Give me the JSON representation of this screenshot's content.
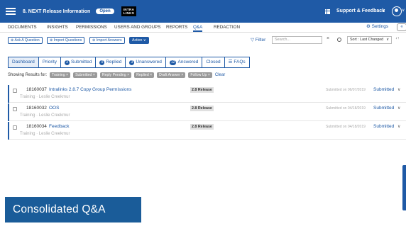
{
  "header": {
    "app_title": "8. NEXT Release Information",
    "status_pill": "Open",
    "logo_line1": "INTRA",
    "logo_line2": "LINKS",
    "support_label": "Support & Feedback",
    "chevron": "∨",
    "user_chevron": "∨",
    "colors": {
      "brand": "#1f5aa6",
      "caption_bg": "#1a5c99"
    }
  },
  "nav": {
    "items": [
      "DOCUMENTS",
      "INSIGHTS",
      "PERMISSIONS",
      "USERS AND GROUPS",
      "REPORTS",
      "Q&A",
      "REDACTION"
    ],
    "active": "Q&A",
    "settings_label": "⚙ Settings",
    "collapse_glyph": "«"
  },
  "toolbar": {
    "ask_question": "⊕ Ask A Question",
    "import_questions": "⊕ Import Questions",
    "import_answers": "⊕ Import Answers",
    "action": "Action ∨",
    "filter_label": "▽ Filter",
    "search_placeholder": "Search...",
    "clear_glyph": "×",
    "sort_label": "Sort : Last Changed",
    "sort_chevron": "∨",
    "sort_direction_glyph": "↓↑"
  },
  "tabs": [
    {
      "label": "Dashboard",
      "badge": ""
    },
    {
      "label": "Priority",
      "badge": ""
    },
    {
      "label": "Submitted",
      "badge": "3"
    },
    {
      "label": "Replied",
      "badge": "0"
    },
    {
      "label": "Unanswered",
      "badge": "3"
    },
    {
      "label": "Answered",
      "badge": "12"
    },
    {
      "label": "Closed",
      "badge": ""
    },
    {
      "label": "FAQs",
      "badge": ""
    }
  ],
  "faq_prefix": "☰",
  "results": {
    "label": "Showing Results for:",
    "chips": [
      "Training ×",
      "Submitted ×",
      "Reply Pending ×",
      "Replied ×",
      "Draft Answer ×",
      "Follow Up ×"
    ],
    "clear_label": "Clear"
  },
  "rows": [
    {
      "number": "18160037",
      "title": "Intralinks 2.8.7 Copy Group Permissions",
      "subtitle": "Training · Leslie Creekmur",
      "release": "2.8 Release",
      "submitted_on": "Submitted on 06/07/2019",
      "status": "Submitted",
      "chevron": "∨"
    },
    {
      "number": "18160032",
      "title": "OOS",
      "subtitle": "Training · Leslie Creekmur",
      "release": "2.8 Release",
      "submitted_on": "Submitted on 04/18/2019",
      "status": "Submitted",
      "chevron": "∨"
    },
    {
      "number": "18160034",
      "title": "Feedback",
      "subtitle": "Training · Leslie Creekmur",
      "release": "2.8 Release",
      "submitted_on": "Submitted on 04/18/2019",
      "status": "Submitted",
      "chevron": "∨"
    }
  ],
  "caption": "Consolidated Q&A"
}
